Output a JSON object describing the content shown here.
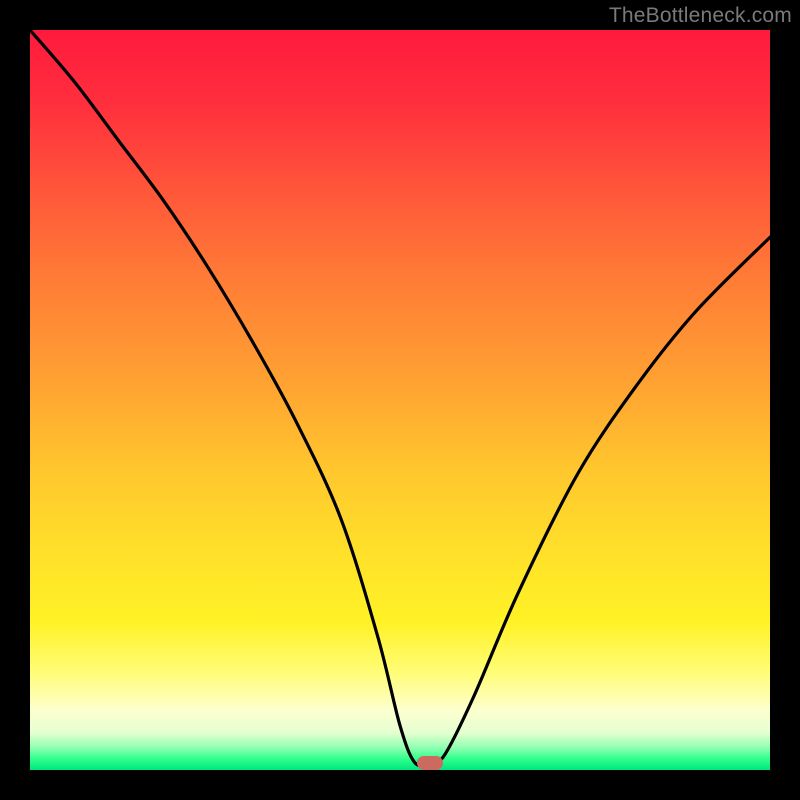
{
  "watermark": "TheBottleneck.com",
  "chart_data": {
    "type": "line",
    "title": "",
    "xlabel": "",
    "ylabel": "",
    "xlim": [
      0,
      100
    ],
    "ylim": [
      0,
      100
    ],
    "grid": false,
    "background": "rainbow-vertical-gradient",
    "marker": {
      "x": 54,
      "y": 1,
      "color": "#cc6a5f"
    },
    "series": [
      {
        "name": "curve",
        "color": "#000000",
        "x": [
          0,
          6,
          12,
          18,
          24,
          30,
          36,
          42,
          47,
          50,
          52,
          54,
          56,
          60,
          66,
          74,
          82,
          90,
          100
        ],
        "y": [
          100,
          93,
          85,
          77,
          68,
          58,
          47,
          34,
          18,
          6,
          1,
          1,
          2,
          10,
          24,
          40,
          52,
          62,
          72
        ]
      }
    ]
  },
  "plot_geometry": {
    "inner_width": 740,
    "inner_height": 740,
    "offset_left": 30,
    "offset_top": 30
  }
}
